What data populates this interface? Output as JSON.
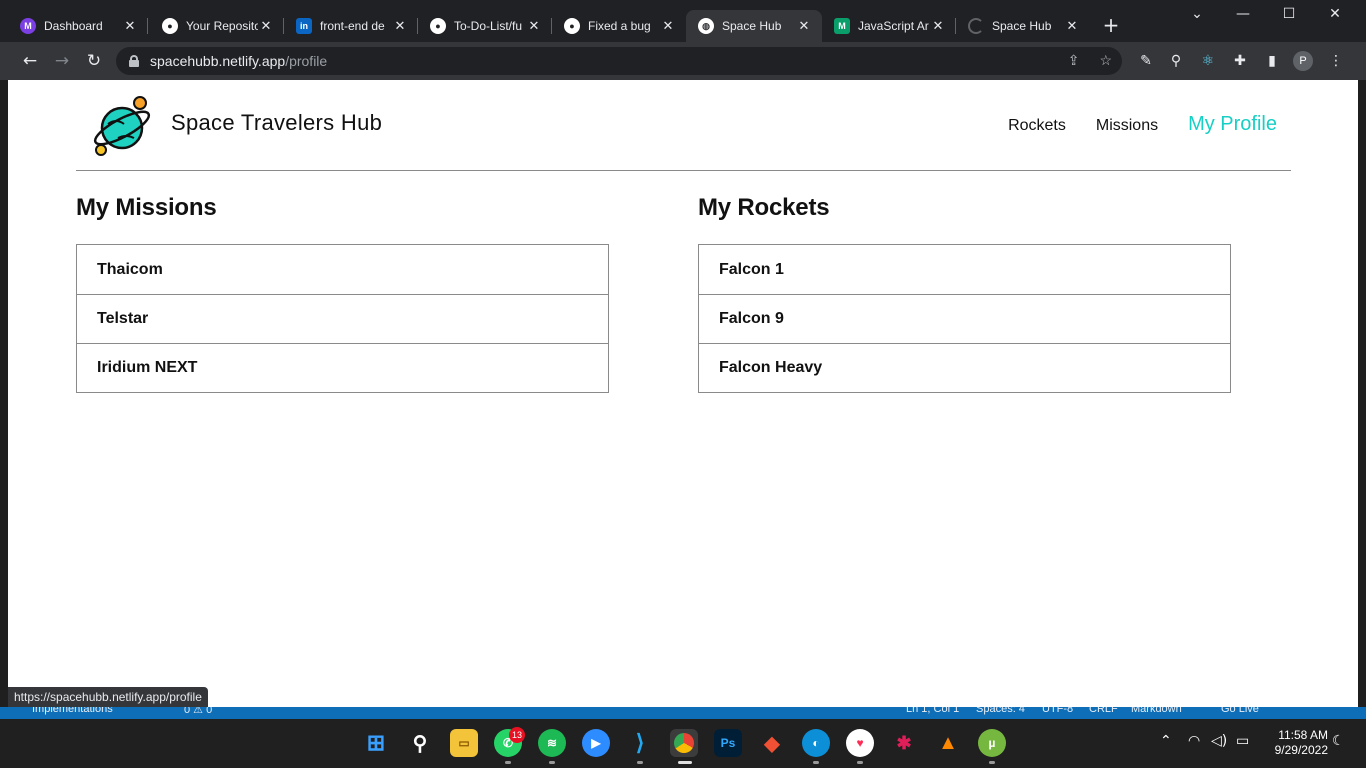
{
  "browser": {
    "tabs": [
      {
        "title": "Dashboard",
        "icon": "dashboard-icon",
        "color": "#7b3fe4",
        "glyph": "M"
      },
      {
        "title": "Your Reposito",
        "icon": "github-icon",
        "color": "#ffffff",
        "glyph": "●"
      },
      {
        "title": "front-end de",
        "icon": "linkedin-icon",
        "color": "#0a66c2",
        "glyph": "in"
      },
      {
        "title": "To-Do-List/fu",
        "icon": "github-icon",
        "color": "#ffffff",
        "glyph": "●"
      },
      {
        "title": "Fixed a bug",
        "icon": "github-icon",
        "color": "#ffffff",
        "glyph": "●"
      },
      {
        "title": "Space Hub",
        "icon": "globe-icon",
        "color": "#ffffff",
        "glyph": "◍"
      },
      {
        "title": "JavaScript Ar",
        "icon": "microverse-icon",
        "color": "#0a9e6a",
        "glyph": "M"
      },
      {
        "title": "Space Hub",
        "icon": "loading-icon",
        "color": "#5f6368",
        "glyph": "◌"
      }
    ],
    "active_tab_index": 5,
    "url_host": "spacehubb.netlify.app",
    "url_path": "/profile",
    "profile_initial": "P",
    "status_url": "https://spacehubb.netlify.app/profile"
  },
  "app": {
    "brand": "Space Travelers Hub",
    "nav": [
      {
        "label": "Rockets",
        "active": false
      },
      {
        "label": "Missions",
        "active": false
      },
      {
        "label": "My Profile",
        "active": true
      }
    ],
    "accent_color": "#18cfc5",
    "missions": {
      "title": "My Missions",
      "items": [
        "Thaicom",
        "Telstar",
        "Iridium NEXT"
      ]
    },
    "rockets": {
      "title": "My Rockets",
      "items": [
        "Falcon 1",
        "Falcon 9",
        "Falcon Heavy"
      ]
    }
  },
  "vscode_status": {
    "left": "Implementations",
    "problems": "0 ⚠ 0",
    "position": "Ln 1, Col 1",
    "spaces": "Spaces: 4",
    "encoding": "UTF-8",
    "eol": "CRLF",
    "language": "Markdown",
    "golive": "Go Live"
  },
  "taskbar": {
    "whatsapp_badge": "13",
    "time": "11:58 AM",
    "date": "9/29/2022"
  }
}
